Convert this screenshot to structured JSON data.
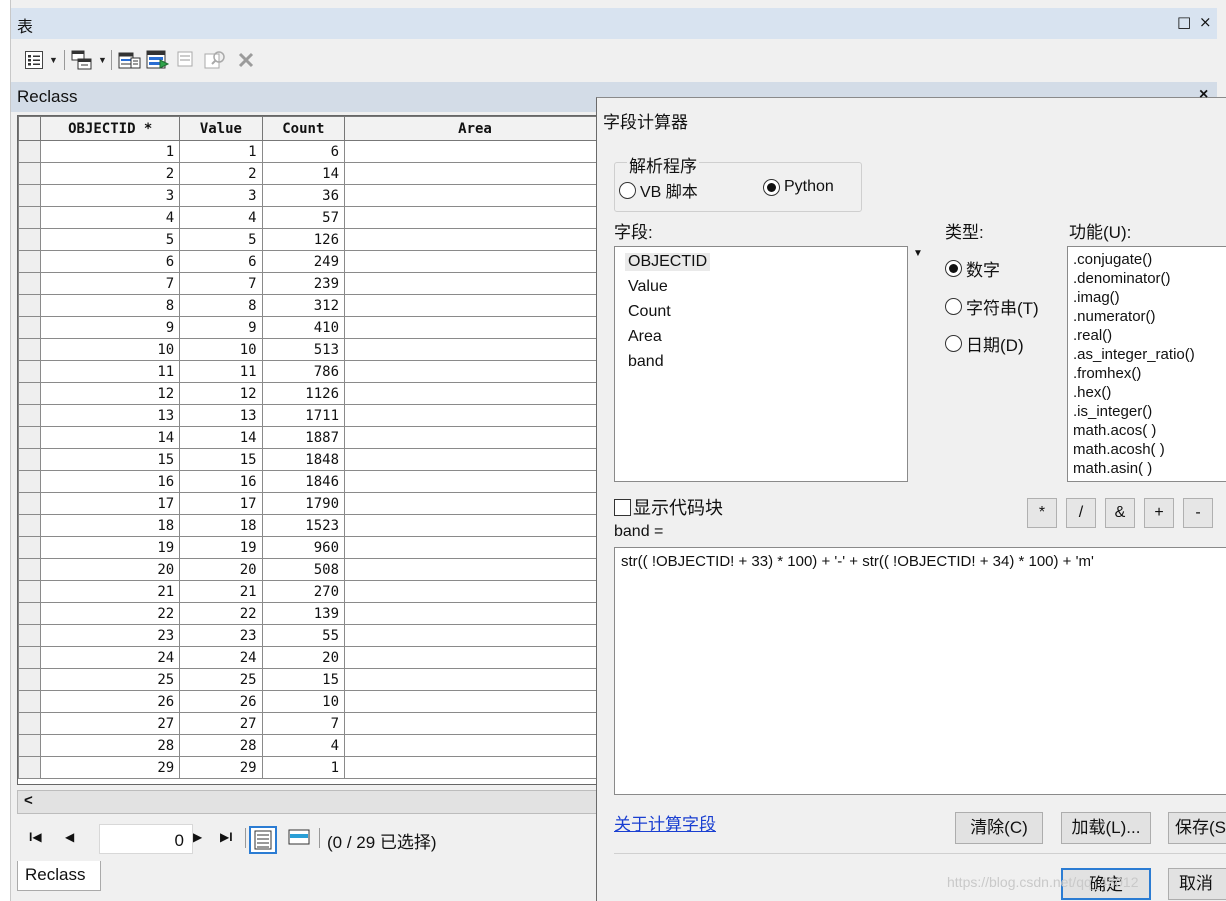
{
  "table_window": {
    "title": "表",
    "restore_glyph": "□",
    "close_glyph": "×",
    "layer_name": "Reclass",
    "layer_close_glyph": "×",
    "columns": [
      "OBJECTID *",
      "Value",
      "Count",
      "Area"
    ],
    "rows": [
      [
        1,
        1,
        6
      ],
      [
        2,
        2,
        14
      ],
      [
        3,
        3,
        36
      ],
      [
        4,
        4,
        57
      ],
      [
        5,
        5,
        126
      ],
      [
        6,
        6,
        249
      ],
      [
        7,
        7,
        239
      ],
      [
        8,
        8,
        312
      ],
      [
        9,
        9,
        410
      ],
      [
        10,
        10,
        513
      ],
      [
        11,
        11,
        786
      ],
      [
        12,
        12,
        1126
      ],
      [
        13,
        13,
        1711
      ],
      [
        14,
        14,
        1887
      ],
      [
        15,
        15,
        1848
      ],
      [
        16,
        16,
        1846
      ],
      [
        17,
        17,
        1790
      ],
      [
        18,
        18,
        1523
      ],
      [
        19,
        19,
        960
      ],
      [
        20,
        20,
        508
      ],
      [
        21,
        21,
        270
      ],
      [
        22,
        22,
        139
      ],
      [
        23,
        23,
        55
      ],
      [
        24,
        24,
        20
      ],
      [
        25,
        25,
        15
      ],
      [
        26,
        26,
        10
      ],
      [
        27,
        27,
        7
      ],
      [
        28,
        28,
        4
      ],
      [
        29,
        29,
        1
      ]
    ],
    "scroll_left_glyph": "<",
    "nav": {
      "first_glyph": "I◀",
      "prev_glyph": "◀",
      "record_value": "0",
      "next_glyph": "▶",
      "last_glyph": "▶I",
      "status": "(0 / 29 已选择)"
    },
    "tab_label": "Reclass"
  },
  "icons": {
    "toolbar": [
      "table-options-icon",
      "related-tables-icon",
      "select-by-attributes-icon",
      "switch-selection-icon",
      "clear-selection-icon",
      "zoom-to-selected-icon",
      "delete-selected-icon"
    ]
  },
  "field_calculator": {
    "title": "字段计算器",
    "close_glyph": "×",
    "parser": {
      "legend": "解析程序",
      "options": [
        "VB 脚本",
        "Python"
      ],
      "selected": "Python"
    },
    "fields_label": "字段:",
    "fields": [
      "OBJECTID",
      "Value",
      "Count",
      "Area",
      "band"
    ],
    "selected_field": "OBJECTID",
    "type_label": "类型:",
    "types": [
      "数字",
      "字符串(T)",
      "日期(D)"
    ],
    "selected_type": "数字",
    "functions_label": "功能(U):",
    "functions": [
      ".conjugate()",
      ".denominator()",
      ".imag()",
      ".numerator()",
      ".real()",
      ".as_integer_ratio()",
      ".fromhex()",
      ".hex()",
      ".is_integer()",
      "math.acos( )",
      "math.acosh( )",
      "math.asin( )"
    ],
    "show_codeblock_label": "显示代码块",
    "show_codeblock_checked": false,
    "operators": [
      "*",
      "/",
      "&",
      "+",
      "-"
    ],
    "target_label": "band =",
    "expression": "str(( !OBJECTID! + 33) * 100) + '-' + str(( !OBJECTID! + 34) * 100) + 'm'",
    "help_link": "关于计算字段",
    "buttons": {
      "clear": "清除(C)",
      "load": "加载(L)...",
      "save": "保存(S",
      "ok": "确定",
      "cancel": "取消"
    }
  },
  "watermark": "https://blog.csdn.net/qq_43012"
}
